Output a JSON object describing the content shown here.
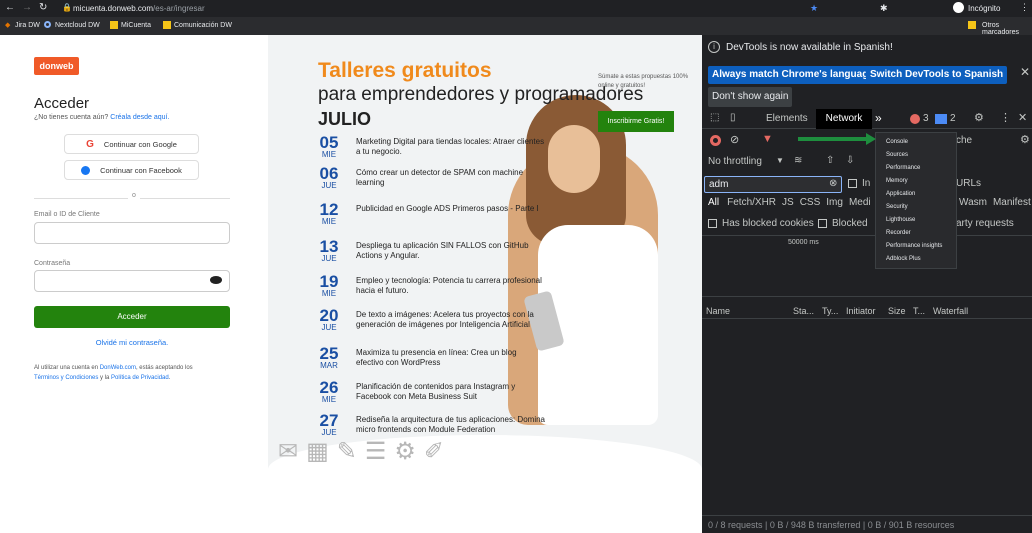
{
  "browser": {
    "url_host": "micuenta.donweb.com",
    "url_path": "/es-ar/ingresar",
    "incognito": "Incógnito",
    "bookmarks": [
      "Jira DW",
      "Nextcloud DW",
      "MiCuenta",
      "Comunicación DW"
    ],
    "other_bookmarks": "Otros marcadores"
  },
  "login": {
    "logo": "donweb",
    "title": "Acceder",
    "no_account": "¿No tienes cuenta aún?",
    "create_link": "Créala desde aquí.",
    "google": "Continuar con Google",
    "facebook": "Continuar con Facebook",
    "divider": "o",
    "email_label": "Email o ID de Cliente",
    "password_label": "Contraseña",
    "submit": "Acceder",
    "forgot": "Olvidé mi contraseña.",
    "terms_pre": "Al utilizar una cuenta en ",
    "terms_site": "DonWeb.com",
    "terms_mid": ", estás aceptando los",
    "terms_link1": "Términos y Condiciones",
    "terms_and": " y la ",
    "terms_link2": "Política de Privacidad",
    "terms_end": "."
  },
  "promo": {
    "title": "Talleres gratuitos",
    "subtitle": "para emprendedores y programadores",
    "side_text": "Súmate a estas propuestas 100% online y gratuitos!",
    "cta": "Inscribirme Gratis!",
    "month": "JULIO",
    "events": [
      {
        "day": "05",
        "month": "MIE",
        "title": "Marketing Digital para tiendas locales: Atraer clientes a tu negocio."
      },
      {
        "day": "06",
        "month": "JUE",
        "title": "Cómo crear un detector de SPAM con machine learning"
      },
      {
        "day": "12",
        "month": "MIE",
        "title": "Publicidad en Google ADS Primeros pasos - Parte I"
      },
      {
        "day": "13",
        "month": "JUE",
        "title": "Despliega tu aplicación SIN FALLOS con GitHub Actions y Angular."
      },
      {
        "day": "19",
        "month": "MIE",
        "title": "Empleo y tecnología: Potencia tu carrera profesional hacia el futuro."
      },
      {
        "day": "20",
        "month": "JUE",
        "title": "De texto a imágenes: Acelera tus proyectos con la generación de imágenes por Inteligencia Artificial"
      },
      {
        "day": "25",
        "month": "MAR",
        "title": "Maximiza tu presencia en línea: Crea un blog efectivo con WordPress"
      },
      {
        "day": "26",
        "month": "MIE",
        "title": "Planificación de contenidos para Instagram y Facebook con Meta Business Suit"
      },
      {
        "day": "27",
        "month": "JUE",
        "title": "Rediseña la arquitectura de tus aplicaciones: Domina micro frontends con Module Federation"
      }
    ]
  },
  "devtools": {
    "banner": "DevTools is now available in Spanish!",
    "btn_match": "Always match Chrome's language",
    "btn_switch": "Switch DevTools to Spanish",
    "btn_dont": "Don't show again",
    "tabs": {
      "elements": "Elements",
      "network": "Network",
      "more": "»"
    },
    "errors": "3",
    "messages": "2",
    "throttling": "No throttling",
    "filter_value": "adm",
    "invert": "In",
    "urls": "URLs",
    "cache": "che",
    "types": [
      "All",
      "Fetch/XHR",
      "JS",
      "CSS",
      "Img",
      "Medi"
    ],
    "types_right": [
      "Wasm",
      "Manifest"
    ],
    "blocked_cookies": "Has blocked cookies",
    "blocked": "Blocked",
    "third_party": "arty requests",
    "timeline": "50000 ms",
    "columns": [
      "Name",
      "Sta...",
      "Ty...",
      "Initiator",
      "Size",
      "T...",
      "Waterfall"
    ],
    "status": "0 / 8 requests  |  0 B / 948 B transferred  |  0 B / 901 B resources",
    "menu": [
      "Console",
      "Sources",
      "Performance",
      "Memory",
      "Application",
      "Security",
      "Lighthouse",
      "Recorder",
      "Performance insights",
      "Adblock Plus"
    ]
  }
}
